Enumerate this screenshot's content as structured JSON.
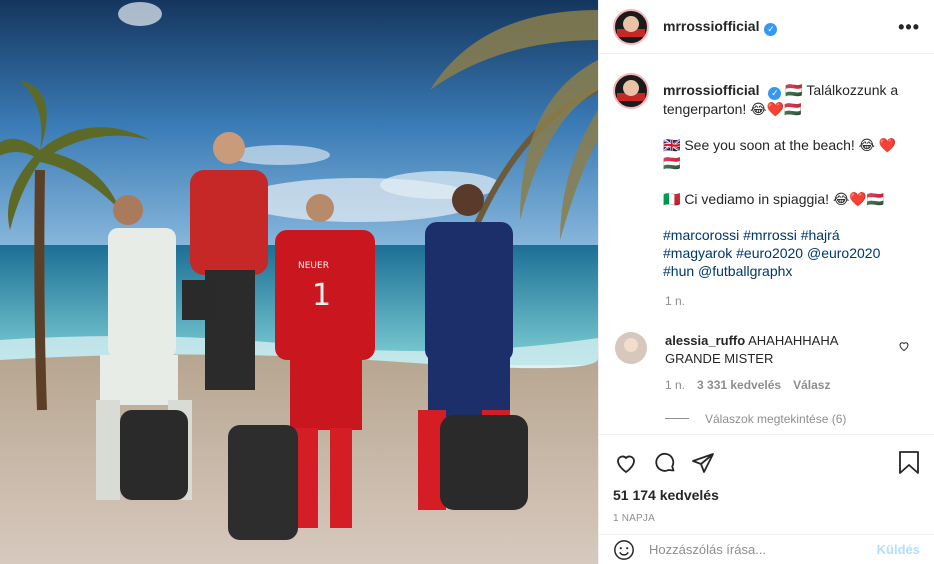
{
  "post": {
    "photo_alt": "",
    "username": "mrrossiofficial",
    "verified_mark": "✓",
    "more_icon": "•••"
  },
  "caption": {
    "username": "mrrossiofficial",
    "line_hu": "🇭🇺 Találkozzunk a tengerparton! 😂❤️🇭🇺",
    "line_en": "🇬🇧 See you soon at the beach! 😂 ❤️🇭🇺",
    "line_it": "🇮🇹 Ci vediamo in spiaggia! 😂❤️🇭🇺",
    "hashtags": "#marcorossi #mrrossi #hajrá #magyarok #euro2020 @euro2020 #hun @futballgraphx",
    "time": "1 n."
  },
  "comment": {
    "username": "alessia_ruffo",
    "text": "AHAHAHHAHA GRANDE MISTER",
    "time": "1 n.",
    "likes": "3 331 kedvelés",
    "reply": "Válasz",
    "view_replies": "Válaszok megtekintése (6)"
  },
  "actions": {
    "likes": "51 174 kedvelés",
    "date": "1 napja"
  },
  "add_comment": {
    "placeholder": "Hozzászólás írása...",
    "post_label": "Küldés"
  },
  "colors": {
    "link": "#00376b",
    "verified": "#3897f0",
    "post_button": "#b2dffc",
    "heart": "#ed4956"
  }
}
